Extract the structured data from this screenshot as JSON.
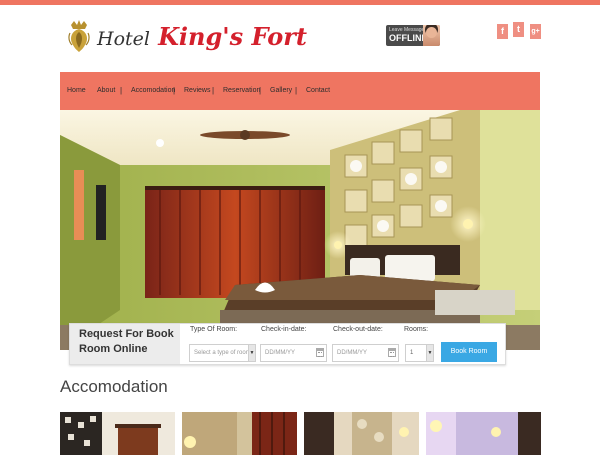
{
  "logo": {
    "hotel": "Hotel",
    "name": "King's Fort"
  },
  "chat_badge": {
    "small": "Leave Message",
    "status": "OFFLINE"
  },
  "social": [
    {
      "icon": "facebook-icon",
      "glyph": "f"
    },
    {
      "icon": "twitter-icon",
      "glyph": "t"
    },
    {
      "icon": "google-plus-icon",
      "glyph": "g+"
    }
  ],
  "nav": {
    "items": [
      "Home",
      "About",
      "Accomodation",
      "Reviews",
      "Reservation",
      "Gallery",
      "Contact"
    ]
  },
  "booking": {
    "title_line1": "Request For Book",
    "title_line2": "Room Online",
    "room_type_label": "Type Of Room:",
    "room_type_value": "Select a type of room",
    "checkin_label": "Check-in-date:",
    "checkin_placeholder": "DD/MM/YY",
    "checkout_label": "Check-out-date:",
    "checkout_placeholder": "DD/MM/YY",
    "rooms_label": "Rooms:",
    "rooms_value": "1",
    "button": "Book Room"
  },
  "section": {
    "title": "Accomodation"
  },
  "colors": {
    "accent": "#ef7561",
    "brand_red": "#d4202c",
    "button_blue": "#3aa8e4"
  }
}
